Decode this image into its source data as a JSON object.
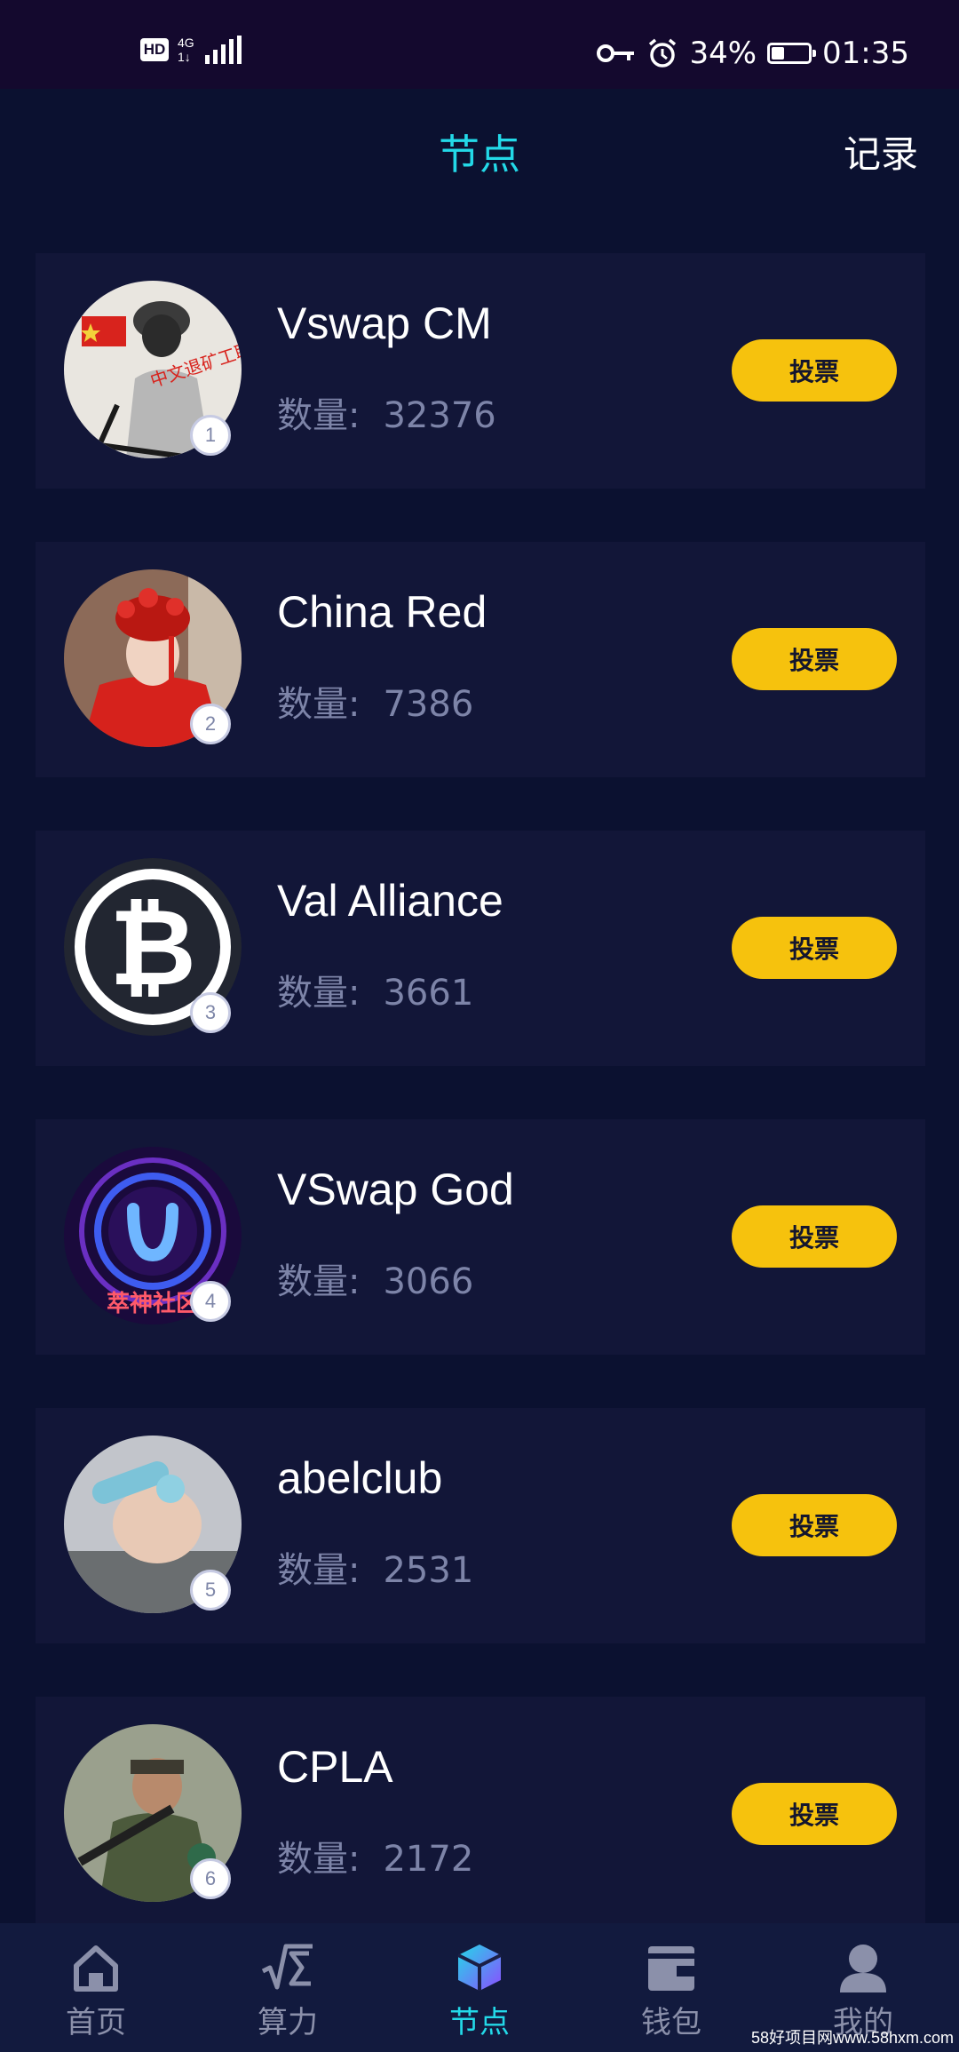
{
  "status_bar": {
    "hd": "HD",
    "network": "4G",
    "network_sub": "1↓",
    "battery_percent": "34%",
    "battery_level": 0.34,
    "time": "01:35"
  },
  "header": {
    "title": "节点",
    "records": "记录"
  },
  "nodes": [
    {
      "rank": "1",
      "name": "Vswap CM",
      "count_label": "数量:",
      "count": "32376",
      "vote_label": "投票"
    },
    {
      "rank": "2",
      "name": "China Red",
      "count_label": "数量:",
      "count": "7386",
      "vote_label": "投票"
    },
    {
      "rank": "3",
      "name": "Val Alliance",
      "count_label": "数量:",
      "count": "3661",
      "vote_label": "投票"
    },
    {
      "rank": "4",
      "name": "VSwap God",
      "count_label": "数量:",
      "count": "3066",
      "vote_label": "投票",
      "avatar_text": "萃神社区"
    },
    {
      "rank": "5",
      "name": "abelclub",
      "count_label": "数量:",
      "count": "2531",
      "vote_label": "投票"
    },
    {
      "rank": "6",
      "name": "CPLA",
      "count_label": "数量:",
      "count": "2172",
      "vote_label": "投票"
    }
  ],
  "bottom_nav": [
    {
      "label": "首页",
      "icon": "home-icon",
      "active": false
    },
    {
      "label": "算力",
      "icon": "sqrt-sigma-icon",
      "active": false
    },
    {
      "label": "节点",
      "icon": "cube-icon",
      "active": true
    },
    {
      "label": "钱包",
      "icon": "wallet-icon",
      "active": false
    },
    {
      "label": "我的",
      "icon": "user-icon",
      "active": false
    }
  ],
  "watermark": "58好项目网www.58hxm.com",
  "colors": {
    "background": "#0b1130",
    "card": "#121638",
    "accent": "#23d9e8",
    "vote_button": "#f6c20d",
    "muted_text": "#7d84a8"
  }
}
